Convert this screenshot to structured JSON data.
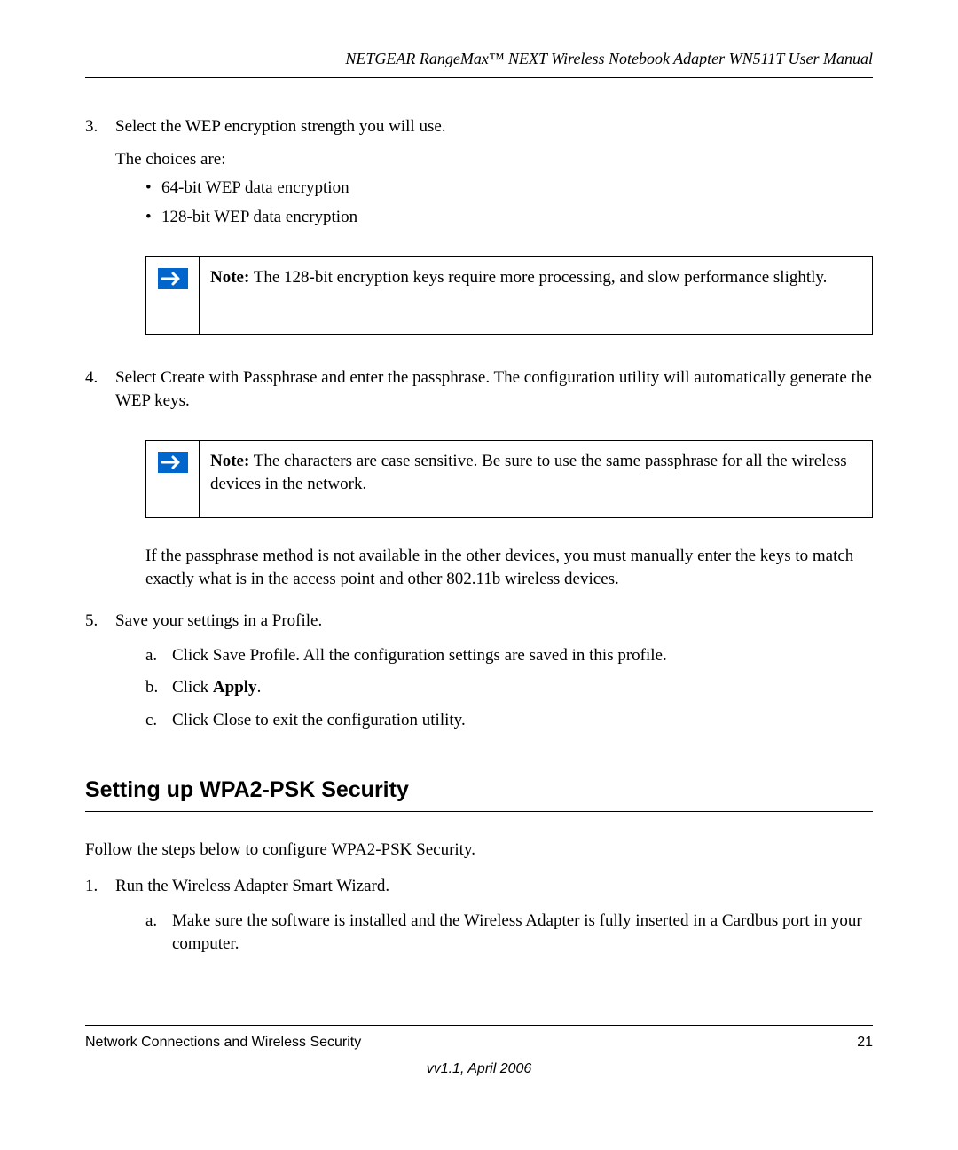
{
  "header": {
    "title": "NETGEAR RangeMax™ NEXT Wireless Notebook Adapter WN511T User Manual"
  },
  "steps": {
    "step3": {
      "num": "3.",
      "text": "Select the WEP encryption strength you will use.",
      "sub": "The choices are:",
      "bullets": [
        "64-bit WEP data encryption",
        "128-bit WEP data encryption"
      ]
    },
    "note1": {
      "label": "Note:",
      "text": " The 128-bit encryption keys require more processing, and slow performance slightly."
    },
    "step4": {
      "num": "4.",
      "text": "Select Create with Passphrase and enter the passphrase. The configuration utility will automatically generate the WEP keys."
    },
    "note2": {
      "label": "Note:",
      "text": " The characters are case sensitive. Be sure to use the same passphrase for all the wireless devices in the network."
    },
    "afterNote2": "If the passphrase method is not available in the other devices, you must manually enter the keys to match exactly what is in the access point and other 802.11b wireless devices.",
    "step5": {
      "num": "5.",
      "text": "Save your settings in a Profile.",
      "sub": [
        {
          "letter": "a.",
          "text": "Click Save Profile. All the configuration settings are saved in this profile."
        },
        {
          "letter": "b.",
          "prefix": "Click ",
          "bold": "Apply",
          "suffix": "."
        },
        {
          "letter": "c.",
          "text": "Click Close to exit the configuration utility."
        }
      ]
    }
  },
  "section": {
    "heading": "Setting up WPA2-PSK Security",
    "intro": "Follow the steps below to configure WPA2-PSK Security.",
    "step1": {
      "num": "1.",
      "text": "Run the Wireless Adapter Smart Wizard.",
      "sub": [
        {
          "letter": "a.",
          "text": "Make sure the software is installed and the Wireless Adapter is fully inserted in a Cardbus port in your computer."
        }
      ]
    }
  },
  "footer": {
    "left": "Network Connections and Wireless Security",
    "right": "21",
    "version": "vv1.1, April 2006"
  }
}
